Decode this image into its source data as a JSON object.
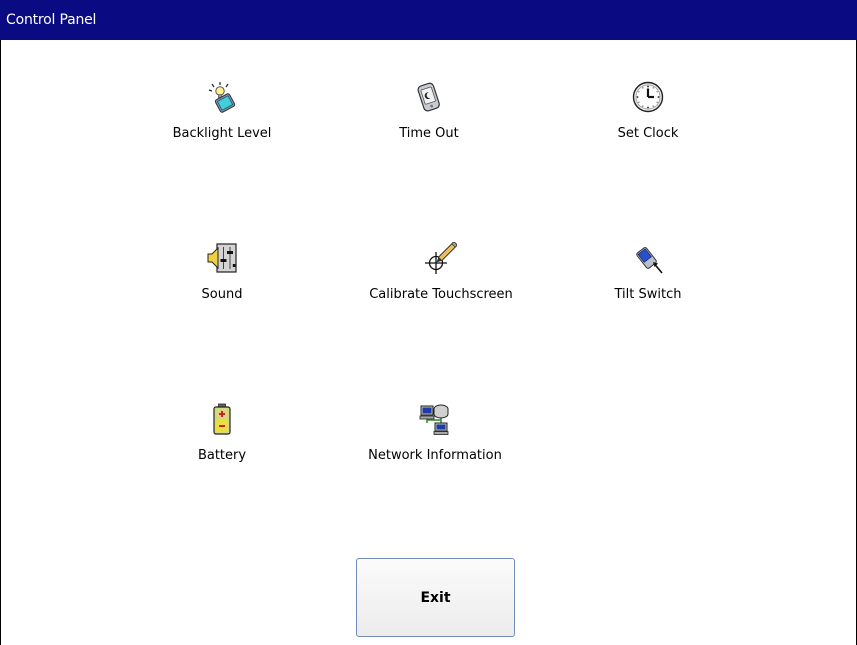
{
  "window": {
    "title": "Control Panel"
  },
  "applets": [
    {
      "label": "Backlight Level",
      "icon": "backlight-icon"
    },
    {
      "label": "Time Out",
      "icon": "timeout-icon"
    },
    {
      "label": "Set Clock",
      "icon": "clock-icon"
    },
    {
      "label": "Sound",
      "icon": "sound-icon"
    },
    {
      "label": "Calibrate Touchscreen",
      "icon": "calibrate-icon"
    },
    {
      "label": "Tilt Switch",
      "icon": "tilt-switch-icon"
    },
    {
      "label": "Battery",
      "icon": "battery-icon"
    },
    {
      "label": "Network Information",
      "icon": "network-icon"
    }
  ],
  "exit_button": {
    "label": "Exit"
  }
}
